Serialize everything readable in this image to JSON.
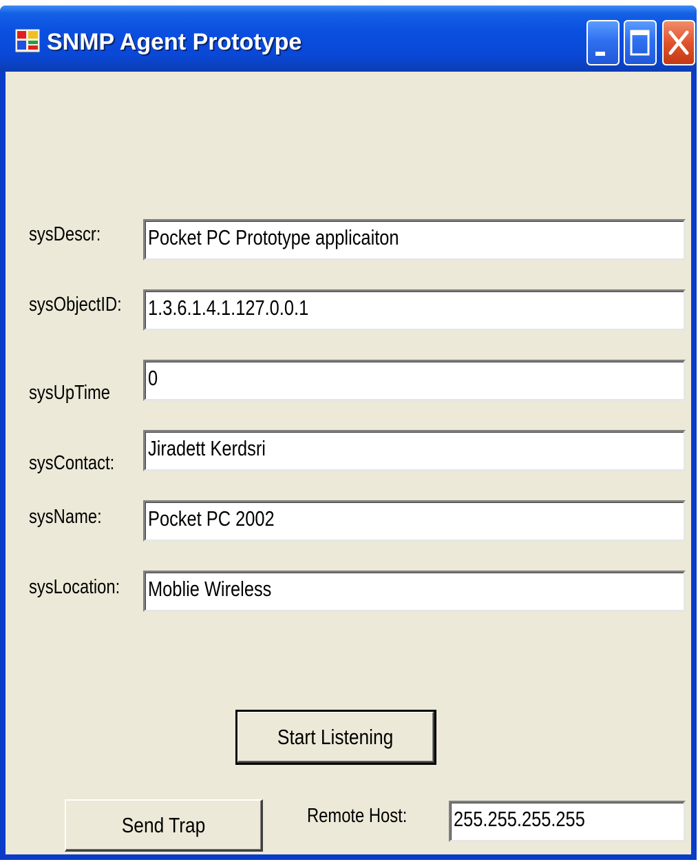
{
  "window": {
    "title": "SNMP Agent Prototype",
    "icon": "app-window-icon",
    "controls": [
      "minimize-icon",
      "maximize-icon",
      "close-icon"
    ]
  },
  "form": {
    "fields": [
      {
        "label": "sysDescr:",
        "value": "Pocket PC Prototype applicaiton"
      },
      {
        "label": "sysObjectID:",
        "value": "1.3.6.1.4.1.127.0.0.1"
      },
      {
        "label": "sysUpTime",
        "value": "0"
      },
      {
        "label": "sysContact:",
        "value": "Jiradett Kerdsri"
      },
      {
        "label": "sysName:",
        "value": "Pocket PC 2002"
      },
      {
        "label": "sysLocation:",
        "value": "Moblie Wireless"
      }
    ],
    "start_button": "Start Listening",
    "send_trap_button": "Send Trap",
    "remote_host_label": "Remote Host:",
    "remote_host_value": "255.255.255.255"
  },
  "colors": {
    "titlebar": "#0a4fe0",
    "client_bg": "#ece9d8",
    "close_button": "#e0532c"
  }
}
